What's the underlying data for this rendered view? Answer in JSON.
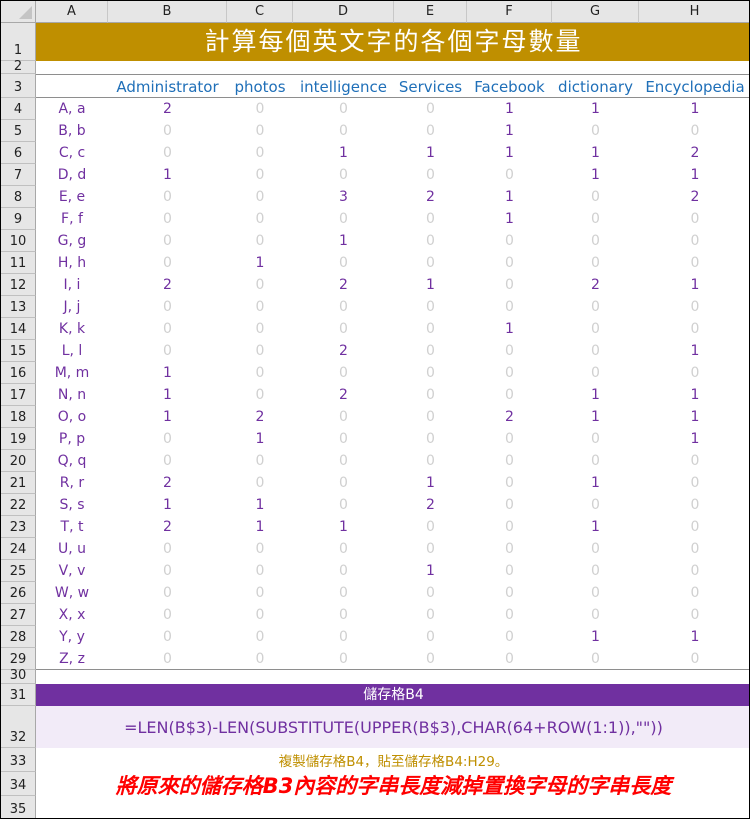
{
  "columns": [
    "A",
    "B",
    "C",
    "D",
    "E",
    "F",
    "G",
    "H"
  ],
  "rows": [
    "1",
    "2",
    "3",
    "4",
    "5",
    "6",
    "7",
    "8",
    "9",
    "10",
    "11",
    "12",
    "13",
    "14",
    "15",
    "16",
    "17",
    "18",
    "19",
    "20",
    "21",
    "22",
    "23",
    "24",
    "25",
    "26",
    "27",
    "28",
    "29",
    "30",
    "31",
    "32",
    "33",
    "34",
    "35"
  ],
  "title": "計算每個英文字的各個字母數量",
  "words": [
    "Administrator",
    "photos",
    "intelligence",
    "Services",
    "Facebook",
    "dictionary",
    "Encyclopedia"
  ],
  "letters": [
    "A, a",
    "B, b",
    "C, c",
    "D, d",
    "E, e",
    "F, f",
    "G, g",
    "H, h",
    "I, i",
    "J, j",
    "K, k",
    "L, l",
    "M, m",
    "N, n",
    "O, o",
    "P, p",
    "Q, q",
    "R, r",
    "S, s",
    "T, t",
    "U, u",
    "V, v",
    "W, w",
    "X, x",
    "Y, y",
    "Z, z"
  ],
  "counts": [
    [
      2,
      0,
      0,
      0,
      1,
      1,
      1
    ],
    [
      0,
      0,
      0,
      0,
      1,
      0,
      0
    ],
    [
      0,
      0,
      1,
      1,
      1,
      1,
      2
    ],
    [
      1,
      0,
      0,
      0,
      0,
      1,
      1
    ],
    [
      0,
      0,
      3,
      2,
      1,
      0,
      2
    ],
    [
      0,
      0,
      0,
      0,
      1,
      0,
      0
    ],
    [
      0,
      0,
      1,
      0,
      0,
      0,
      0
    ],
    [
      0,
      1,
      0,
      0,
      0,
      0,
      0
    ],
    [
      2,
      0,
      2,
      1,
      0,
      2,
      1
    ],
    [
      0,
      0,
      0,
      0,
      0,
      0,
      0
    ],
    [
      0,
      0,
      0,
      0,
      1,
      0,
      0
    ],
    [
      0,
      0,
      2,
      0,
      0,
      0,
      1
    ],
    [
      1,
      0,
      0,
      0,
      0,
      0,
      0
    ],
    [
      1,
      0,
      2,
      0,
      0,
      1,
      1
    ],
    [
      1,
      2,
      0,
      0,
      2,
      1,
      1
    ],
    [
      0,
      1,
      0,
      0,
      0,
      0,
      1
    ],
    [
      0,
      0,
      0,
      0,
      0,
      0,
      0
    ],
    [
      2,
      0,
      0,
      1,
      0,
      1,
      0
    ],
    [
      1,
      1,
      0,
      2,
      0,
      0,
      0
    ],
    [
      2,
      1,
      1,
      0,
      0,
      1,
      0
    ],
    [
      0,
      0,
      0,
      0,
      0,
      0,
      0
    ],
    [
      0,
      0,
      0,
      1,
      0,
      0,
      0
    ],
    [
      0,
      0,
      0,
      0,
      0,
      0,
      0
    ],
    [
      0,
      0,
      0,
      0,
      0,
      0,
      0
    ],
    [
      0,
      0,
      0,
      0,
      0,
      1,
      1
    ],
    [
      0,
      0,
      0,
      0,
      0,
      0,
      0
    ]
  ],
  "formula_header": "儲存格B4",
  "formula": "=LEN(B$3)-LEN(SUBSTITUTE(UPPER(B$3),CHAR(64+ROW(1:1)),\"\"))",
  "note": "複製儲存格B4，貼至儲存格B4:H29。",
  "explanation": "將原來的儲存格B3內容的字串長度減掉置換字母的字串長度",
  "colors": {
    "title_bg": "#bf8f00",
    "word_text": "#1f6fb8",
    "value_text": "#7030a0",
    "zero_text": "#d0d0d0",
    "formula_bar_bg": "#7030a0",
    "formula_bg": "#f2ebf8",
    "note_text": "#bf8f00",
    "explanation_text": "#ff0000"
  }
}
